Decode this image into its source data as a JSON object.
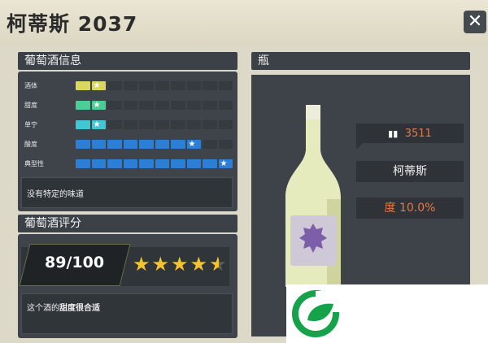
{
  "header": {
    "title": "柯蒂斯 2037",
    "close_label": "✕"
  },
  "left": {
    "info_title": "葡萄酒信息",
    "attributes": [
      {
        "label": "酒体",
        "filled": 2,
        "total": 10,
        "color": "#d9d75e",
        "star_index": 1
      },
      {
        "label": "甜度",
        "filled": 2,
        "total": 10,
        "color": "#48cf98",
        "star_index": 1
      },
      {
        "label": "单宁",
        "filled": 2,
        "total": 10,
        "color": "#41c7d4",
        "star_index": 1
      },
      {
        "label": "酸度",
        "filled": 8,
        "total": 10,
        "color": "#2b7fd8",
        "star_index": 7
      },
      {
        "label": "典型性",
        "filled": 10,
        "total": 10,
        "color": "#2b7fd8",
        "star_index": 9
      }
    ],
    "flavor_text": "没有特定的味道",
    "rating_title": "葡萄酒评分",
    "score": "89/100",
    "stars": 4.5,
    "comment_prefix": "这个酒的",
    "comment_bold": "甜度很合适"
  },
  "right": {
    "title": "瓶",
    "count": "3511",
    "wine_name": "柯蒂斯",
    "abv_label": "度 10.0%",
    "bottle_icon": "wine-bottles-icon"
  },
  "colors": {
    "accent_orange": "#e07a4a",
    "star_yellow": "#f2c230"
  }
}
